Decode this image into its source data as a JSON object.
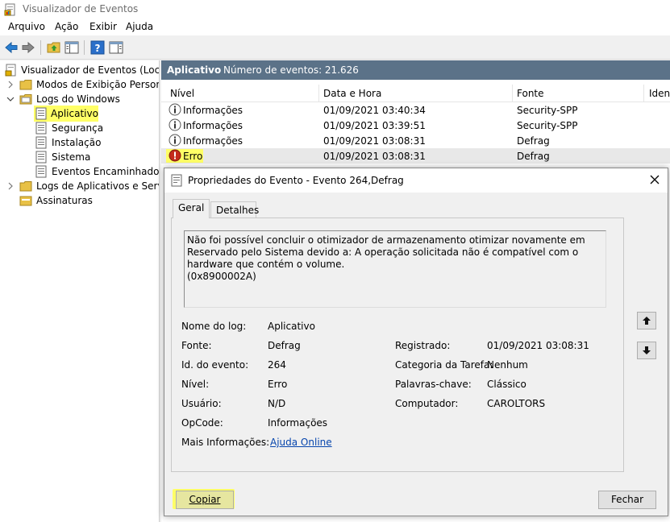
{
  "window": {
    "title": "Visualizador de Eventos"
  },
  "menu": [
    "Arquivo",
    "Ação",
    "Exibir",
    "Ajuda"
  ],
  "tree": {
    "root": "Visualizador de Eventos (Local)",
    "custom_views": "Modos de Exibição Personalizados",
    "windows_logs": "Logs do Windows",
    "application": "Aplicativo",
    "security": "Segurança",
    "setup": "Instalação",
    "system": "Sistema",
    "forwarded": "Eventos Encaminhados",
    "apps_services": "Logs de Aplicativos e Serviços",
    "subscriptions": "Assinaturas"
  },
  "main": {
    "log_name": "Aplicativo",
    "count_label": "Número de eventos: 21.626",
    "columns": [
      "Nível",
      "Data e Hora",
      "Fonte",
      "Ident"
    ],
    "rows": [
      {
        "level": "Informações",
        "datetime": "01/09/2021 03:40:34",
        "source": "Security-SPP",
        "icon": "info-icon"
      },
      {
        "level": "Informações",
        "datetime": "01/09/2021 03:39:51",
        "source": "Security-SPP",
        "icon": "info-icon"
      },
      {
        "level": "Informações",
        "datetime": "01/09/2021 03:08:31",
        "source": "Defrag",
        "icon": "info-icon"
      },
      {
        "level": "Erro",
        "datetime": "01/09/2021 03:08:31",
        "source": "Defrag",
        "icon": "error-icon"
      }
    ]
  },
  "dialog": {
    "title": "Propriedades do Evento - Evento 264,Defrag",
    "tabs": {
      "general": "Geral",
      "details": "Detalhes"
    },
    "description": "Não foi possível concluir o otimizador de armazenamento otimizar novamente em Reservado pelo Sistema devido a: A operação solicitada não é compatível com o hardware que contém o volume.\n(0x8900002A)",
    "fields": {
      "log_name_label": "Nome do log:",
      "log_name_value": "Aplicativo",
      "source_label": "Fonte:",
      "source_value": "Defrag",
      "registered_label": "Registrado:",
      "registered_value": "01/09/2021 03:08:31",
      "event_id_label": "Id. do evento:",
      "event_id_value": "264",
      "task_category_label": "Categoria da Tarefa:",
      "task_category_value": "Nenhum",
      "level_label": "Nível:",
      "level_value": "Erro",
      "keywords_label": "Palavras-chave:",
      "keywords_value": "Clássico",
      "user_label": "Usuário:",
      "user_value": "N/D",
      "computer_label": "Computador:",
      "computer_value": "CAROLTORS",
      "opcode_label": "OpCode:",
      "opcode_value": "Informações",
      "more_info_label": "Mais Informações:",
      "more_info_link": "Ajuda Online"
    },
    "buttons": {
      "copy": "Copiar",
      "close": "Fechar"
    }
  },
  "colors": {
    "header_bg": "#5b7288",
    "highlight": "#ffff66",
    "link": "#0645ad",
    "error": "#c42b1c"
  }
}
